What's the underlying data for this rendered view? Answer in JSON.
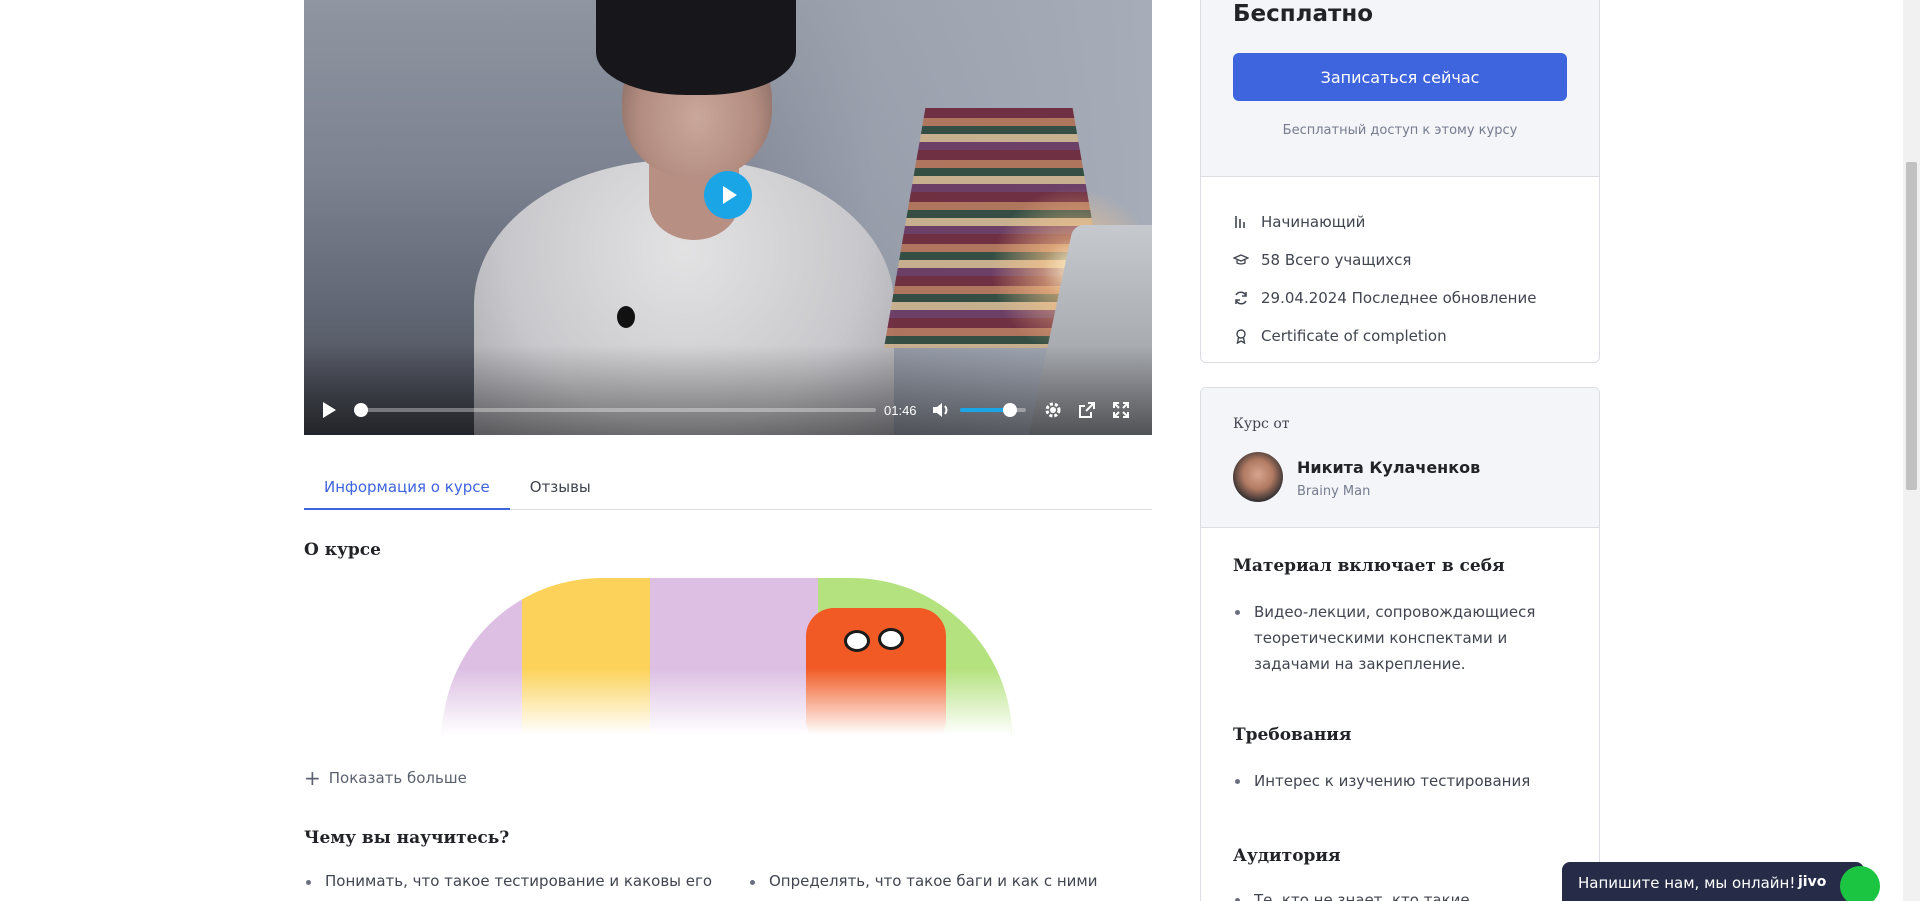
{
  "video": {
    "time": "01:46",
    "progress_fraction": 0.0,
    "volume_fraction": 0.75
  },
  "tabs": [
    {
      "label": "Информация о курсе",
      "active": true
    },
    {
      "label": "Отзывы",
      "active": false
    }
  ],
  "about": {
    "title": "О курсе",
    "show_more": "Показать больше"
  },
  "learn": {
    "title": "Чему вы научитесь?",
    "items": [
      "Понимать, что такое тестирование и каковы его",
      "Определять, что такое баги и как с ними"
    ]
  },
  "pricing": {
    "price": "Бесплатно",
    "enroll_button": "Записаться сейчас",
    "free_note": "Бесплатный доступ к этому курсу"
  },
  "meta": [
    {
      "icon": "level-icon",
      "text": "Начинающий"
    },
    {
      "icon": "graduation-cap-icon",
      "text": "58 Всего учащихся"
    },
    {
      "icon": "refresh-icon",
      "text": "29.04.2024 Последнее обновление"
    },
    {
      "icon": "certificate-icon",
      "text": "Certificate of completion"
    }
  ],
  "author": {
    "by_label": "Курс от",
    "name": "Никита Кулаченков",
    "subtitle": "Brainy Man"
  },
  "materials": {
    "title": "Материал включает в себя",
    "items": [
      "Видео-лекции, сопровождающиеся теоретическими конспектами и задачами на закрепление."
    ]
  },
  "requirements": {
    "title": "Требования",
    "items": [
      "Интерес к изучению тестирования"
    ]
  },
  "audience": {
    "title": "Аудитория",
    "items": [
      "Те, кто не знает, кто такие"
    ]
  },
  "chat": {
    "label": "Напишите нам, мы онлайн!",
    "brand": "jivo"
  },
  "colors": {
    "accent": "#3e64de",
    "video_play": "#19a5e6",
    "chat_bg": "#262c47"
  }
}
